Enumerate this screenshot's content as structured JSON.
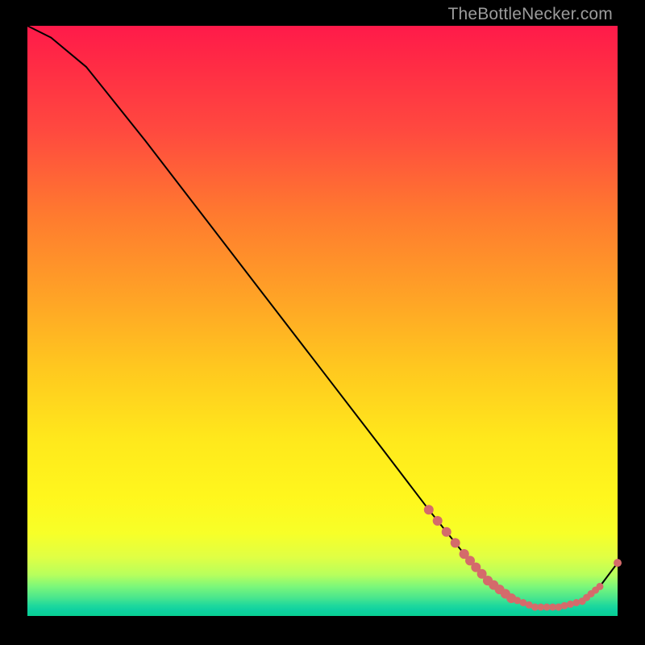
{
  "watermark": "TheBottleNecker.com",
  "chart_data": {
    "type": "line",
    "title": "",
    "xlabel": "",
    "ylabel": "",
    "xlim": [
      0,
      100
    ],
    "ylim": [
      0,
      100
    ],
    "grid": false,
    "series": [
      {
        "name": "curve-0",
        "x": [
          0,
          4,
          10,
          20,
          30,
          40,
          50,
          60,
          68,
          74,
          78,
          82,
          86,
          90,
          94,
          97,
          100
        ],
        "y": [
          100,
          98,
          93,
          80.5,
          67.5,
          54.5,
          41.5,
          28.5,
          18.0,
          10.5,
          6.0,
          3.0,
          1.5,
          1.5,
          2.5,
          5.0,
          9.0
        ]
      }
    ],
    "markers": [
      {
        "series": 0,
        "idx_range": [
          8,
          15
        ],
        "dense": true,
        "color": "#d46b6b"
      },
      {
        "series": 0,
        "x": 100,
        "y": 9.0,
        "color": "#d46b6b"
      }
    ],
    "colors": {
      "curve": "#000000",
      "marker": "#d46b6b",
      "gradient_top": "#ff1a4a",
      "gradient_bottom": "#08cf92"
    }
  }
}
